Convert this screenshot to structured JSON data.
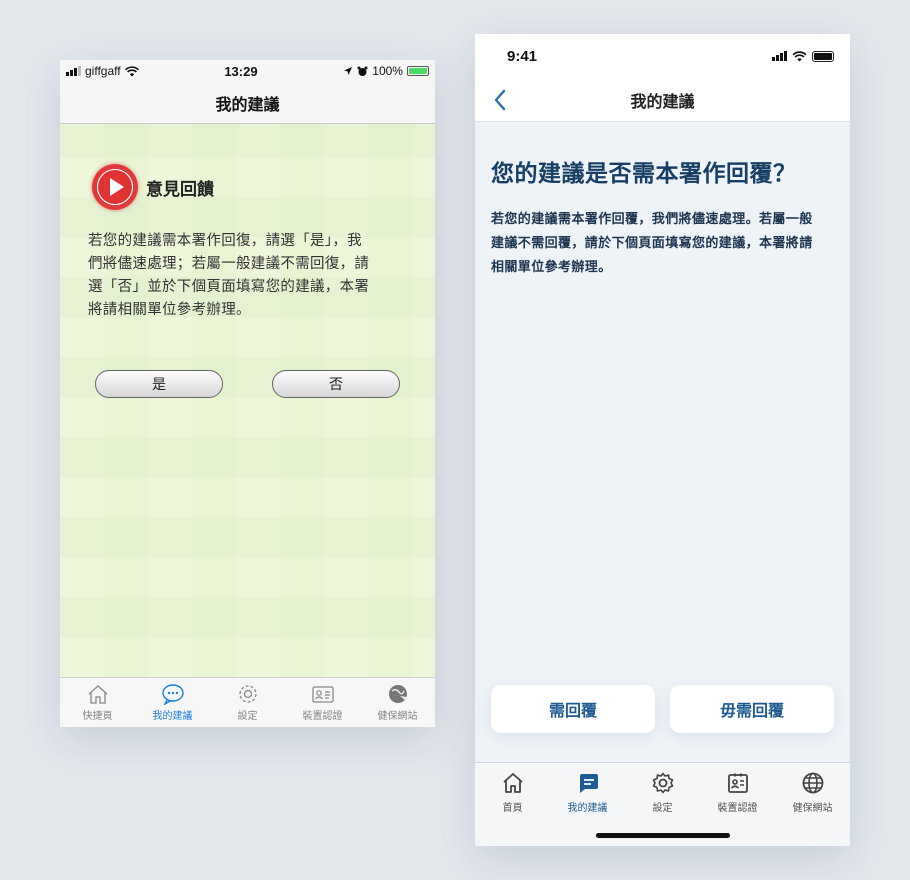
{
  "old_screen": {
    "status": {
      "carrier": "giffgaff",
      "time": "13:29",
      "battery": "100%"
    },
    "nav_title": "我的建議",
    "heading": "意見回饋",
    "body_lines": [
      "若您的建議需本署作回復，請選「是」，我",
      "們將儘速處理；若屬一般建議不需回復，請",
      "選「否」並於下個頁面填寫您的建議，本署",
      "將請相關單位參考辦理。"
    ],
    "yes_label": "是",
    "no_label": "否",
    "tabs": [
      {
        "label": "快捷頁",
        "icon": "home-icon"
      },
      {
        "label": "我的建議",
        "icon": "chat-icon",
        "active": true
      },
      {
        "label": "設定",
        "icon": "gear-icon"
      },
      {
        "label": "裝置認證",
        "icon": "id-card-icon"
      },
      {
        "label": "健保網站",
        "icon": "globe-icon"
      }
    ]
  },
  "new_screen": {
    "status": {
      "time": "9:41"
    },
    "nav_title": "我的建議",
    "heading": "您的建議是否需本署作回覆？",
    "body_lines": [
      "若您的建議需本署作回覆，我們將儘速處理。若屬一般",
      "建議不需回覆，請於下個頁面填寫您的建議，本署將請",
      "相關單位參考辦理。"
    ],
    "need_reply_label": "需回覆",
    "no_reply_label": "毋需回覆",
    "tabs": [
      {
        "label": "首頁",
        "icon": "home-icon"
      },
      {
        "label": "我的建議",
        "icon": "message-icon",
        "active": true
      },
      {
        "label": "設定",
        "icon": "gear-icon"
      },
      {
        "label": "裝置認證",
        "icon": "id-card-icon"
      },
      {
        "label": "健保網站",
        "icon": "globe-icon"
      }
    ]
  },
  "colors": {
    "old_background": "#edf6d9",
    "old_active_tab": "#1a7fe0",
    "new_accent": "#1f5c94",
    "new_heading": "#173f66"
  }
}
